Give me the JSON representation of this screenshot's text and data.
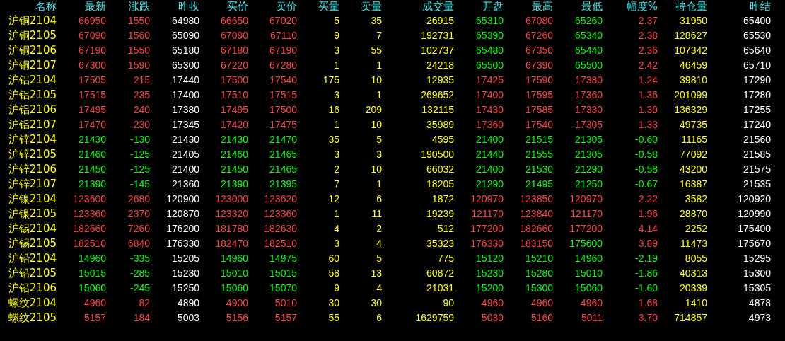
{
  "table": {
    "columns": [
      "名称",
      "最新",
      "涨跌",
      "昨收",
      "买价",
      "卖价",
      "买量",
      "卖量",
      "成交量",
      "开盘",
      "最高",
      "最低",
      "幅度%",
      "持仓量",
      "昨结"
    ],
    "rows": [
      {
        "cells": [
          {
            "text": "沪铜2104",
            "color": "#ffff00"
          },
          {
            "text": "66950",
            "color": "#ff4040"
          },
          {
            "text": "1550",
            "color": "#ff4040"
          },
          {
            "text": "64980",
            "color": "#ffffff"
          },
          {
            "text": "66650",
            "color": "#ff4040"
          },
          {
            "text": "67020",
            "color": "#ff4040"
          },
          {
            "text": "5",
            "color": "#ffff00"
          },
          {
            "text": "35",
            "color": "#ffff00"
          },
          {
            "text": "26915",
            "color": "#ffff00"
          },
          {
            "text": "65310",
            "color": "#00ff00"
          },
          {
            "text": "67080",
            "color": "#ff4040"
          },
          {
            "text": "65260",
            "color": "#00ff00"
          },
          {
            "text": "2.37",
            "color": "#ff4040"
          },
          {
            "text": "31950",
            "color": "#ffff00"
          },
          {
            "text": "65400",
            "color": "#ffffff"
          }
        ]
      },
      {
        "cells": [
          {
            "text": "沪铜2105",
            "color": "#ffff00"
          },
          {
            "text": "67090",
            "color": "#ff4040"
          },
          {
            "text": "1560",
            "color": "#ff4040"
          },
          {
            "text": "65090",
            "color": "#ffffff"
          },
          {
            "text": "67090",
            "color": "#ff4040"
          },
          {
            "text": "67110",
            "color": "#ff4040"
          },
          {
            "text": "9",
            "color": "#ffff00"
          },
          {
            "text": "7",
            "color": "#ffff00"
          },
          {
            "text": "192731",
            "color": "#ffff00"
          },
          {
            "text": "65390",
            "color": "#00ff00"
          },
          {
            "text": "67260",
            "color": "#ff4040"
          },
          {
            "text": "65340",
            "color": "#00ff00"
          },
          {
            "text": "2.38",
            "color": "#ff4040"
          },
          {
            "text": "128627",
            "color": "#ffff00"
          },
          {
            "text": "65530",
            "color": "#ffffff"
          }
        ]
      },
      {
        "cells": [
          {
            "text": "沪铜2106",
            "color": "#ffff00"
          },
          {
            "text": "67190",
            "color": "#ff4040"
          },
          {
            "text": "1550",
            "color": "#ff4040"
          },
          {
            "text": "65180",
            "color": "#ffffff"
          },
          {
            "text": "67180",
            "color": "#ff4040"
          },
          {
            "text": "67190",
            "color": "#ff4040"
          },
          {
            "text": "3",
            "color": "#ffff00"
          },
          {
            "text": "55",
            "color": "#ffff00"
          },
          {
            "text": "102737",
            "color": "#ffff00"
          },
          {
            "text": "65480",
            "color": "#00ff00"
          },
          {
            "text": "67350",
            "color": "#ff4040"
          },
          {
            "text": "65440",
            "color": "#00ff00"
          },
          {
            "text": "2.36",
            "color": "#ff4040"
          },
          {
            "text": "107342",
            "color": "#ffff00"
          },
          {
            "text": "65640",
            "color": "#ffffff"
          }
        ]
      },
      {
        "cells": [
          {
            "text": "沪铜2107",
            "color": "#ffff00"
          },
          {
            "text": "67300",
            "color": "#ff4040"
          },
          {
            "text": "1590",
            "color": "#ff4040"
          },
          {
            "text": "65300",
            "color": "#ffffff"
          },
          {
            "text": "67220",
            "color": "#ff4040"
          },
          {
            "text": "67280",
            "color": "#ff4040"
          },
          {
            "text": "1",
            "color": "#ffff00"
          },
          {
            "text": "1",
            "color": "#ffff00"
          },
          {
            "text": "24218",
            "color": "#ffff00"
          },
          {
            "text": "65500",
            "color": "#00ff00"
          },
          {
            "text": "67390",
            "color": "#ff4040"
          },
          {
            "text": "65500",
            "color": "#00ff00"
          },
          {
            "text": "2.42",
            "color": "#ff4040"
          },
          {
            "text": "46459",
            "color": "#ffff00"
          },
          {
            "text": "65710",
            "color": "#ffffff"
          }
        ]
      },
      {
        "cells": [
          {
            "text": "沪铝2104",
            "color": "#ffff00"
          },
          {
            "text": "17505",
            "color": "#ff4040"
          },
          {
            "text": "215",
            "color": "#ff4040"
          },
          {
            "text": "17440",
            "color": "#ffffff"
          },
          {
            "text": "17500",
            "color": "#ff4040"
          },
          {
            "text": "17540",
            "color": "#ff4040"
          },
          {
            "text": "175",
            "color": "#ffff00"
          },
          {
            "text": "10",
            "color": "#ffff00"
          },
          {
            "text": "12935",
            "color": "#ffff00"
          },
          {
            "text": "17425",
            "color": "#ff4040"
          },
          {
            "text": "17590",
            "color": "#ff4040"
          },
          {
            "text": "17380",
            "color": "#ff4040"
          },
          {
            "text": "1.24",
            "color": "#ff4040"
          },
          {
            "text": "39810",
            "color": "#ffff00"
          },
          {
            "text": "17290",
            "color": "#ffffff"
          }
        ]
      },
      {
        "cells": [
          {
            "text": "沪铝2105",
            "color": "#ffff00"
          },
          {
            "text": "17515",
            "color": "#ff4040"
          },
          {
            "text": "235",
            "color": "#ff4040"
          },
          {
            "text": "17400",
            "color": "#ffffff"
          },
          {
            "text": "17510",
            "color": "#ff4040"
          },
          {
            "text": "17515",
            "color": "#ff4040"
          },
          {
            "text": "3",
            "color": "#ffff00"
          },
          {
            "text": "1",
            "color": "#ffff00"
          },
          {
            "text": "269652",
            "color": "#ffff00"
          },
          {
            "text": "17400",
            "color": "#ff4040"
          },
          {
            "text": "17595",
            "color": "#ff4040"
          },
          {
            "text": "17360",
            "color": "#ff4040"
          },
          {
            "text": "1.36",
            "color": "#ff4040"
          },
          {
            "text": "201099",
            "color": "#ffff00"
          },
          {
            "text": "17280",
            "color": "#ffffff"
          }
        ]
      },
      {
        "cells": [
          {
            "text": "沪铝2106",
            "color": "#ffff00"
          },
          {
            "text": "17495",
            "color": "#ff4040"
          },
          {
            "text": "240",
            "color": "#ff4040"
          },
          {
            "text": "17380",
            "color": "#ffffff"
          },
          {
            "text": "17495",
            "color": "#ff4040"
          },
          {
            "text": "17500",
            "color": "#ff4040"
          },
          {
            "text": "16",
            "color": "#ffff00"
          },
          {
            "text": "209",
            "color": "#ffff00"
          },
          {
            "text": "132115",
            "color": "#ffff00"
          },
          {
            "text": "17430",
            "color": "#ff4040"
          },
          {
            "text": "17585",
            "color": "#ff4040"
          },
          {
            "text": "17330",
            "color": "#ff4040"
          },
          {
            "text": "1.39",
            "color": "#ff4040"
          },
          {
            "text": "136329",
            "color": "#ffff00"
          },
          {
            "text": "17255",
            "color": "#ffffff"
          }
        ]
      },
      {
        "cells": [
          {
            "text": "沪铝2107",
            "color": "#ffff00"
          },
          {
            "text": "17470",
            "color": "#ff4040"
          },
          {
            "text": "230",
            "color": "#ff4040"
          },
          {
            "text": "17345",
            "color": "#ffffff"
          },
          {
            "text": "17420",
            "color": "#ff4040"
          },
          {
            "text": "17475",
            "color": "#ff4040"
          },
          {
            "text": "1",
            "color": "#ffff00"
          },
          {
            "text": "10",
            "color": "#ffff00"
          },
          {
            "text": "35989",
            "color": "#ffff00"
          },
          {
            "text": "17360",
            "color": "#ff4040"
          },
          {
            "text": "17540",
            "color": "#ff4040"
          },
          {
            "text": "17305",
            "color": "#ff4040"
          },
          {
            "text": "1.33",
            "color": "#ff4040"
          },
          {
            "text": "49735",
            "color": "#ffff00"
          },
          {
            "text": "17240",
            "color": "#ffffff"
          }
        ]
      },
      {
        "cells": [
          {
            "text": "沪锌2104",
            "color": "#ffff00"
          },
          {
            "text": "21430",
            "color": "#00ff00"
          },
          {
            "text": "-130",
            "color": "#00ff00"
          },
          {
            "text": "21430",
            "color": "#ffffff"
          },
          {
            "text": "21430",
            "color": "#00ff00"
          },
          {
            "text": "21470",
            "color": "#00ff00"
          },
          {
            "text": "35",
            "color": "#ffff00"
          },
          {
            "text": "5",
            "color": "#ffff00"
          },
          {
            "text": "4595",
            "color": "#ffff00"
          },
          {
            "text": "21400",
            "color": "#00ff00"
          },
          {
            "text": "21515",
            "color": "#00ff00"
          },
          {
            "text": "21305",
            "color": "#00ff00"
          },
          {
            "text": "-0.60",
            "color": "#00ff00"
          },
          {
            "text": "11165",
            "color": "#ffff00"
          },
          {
            "text": "21560",
            "color": "#ffffff"
          }
        ]
      },
      {
        "cells": [
          {
            "text": "沪锌2105",
            "color": "#ffff00"
          },
          {
            "text": "21460",
            "color": "#00ff00"
          },
          {
            "text": "-125",
            "color": "#00ff00"
          },
          {
            "text": "21405",
            "color": "#ffffff"
          },
          {
            "text": "21460",
            "color": "#00ff00"
          },
          {
            "text": "21465",
            "color": "#00ff00"
          },
          {
            "text": "3",
            "color": "#ffff00"
          },
          {
            "text": "3",
            "color": "#ffff00"
          },
          {
            "text": "190500",
            "color": "#ffff00"
          },
          {
            "text": "21440",
            "color": "#00ff00"
          },
          {
            "text": "21555",
            "color": "#00ff00"
          },
          {
            "text": "21305",
            "color": "#00ff00"
          },
          {
            "text": "-0.58",
            "color": "#00ff00"
          },
          {
            "text": "77092",
            "color": "#ffff00"
          },
          {
            "text": "21585",
            "color": "#ffffff"
          }
        ]
      },
      {
        "cells": [
          {
            "text": "沪锌2106",
            "color": "#ffff00"
          },
          {
            "text": "21450",
            "color": "#00ff00"
          },
          {
            "text": "-125",
            "color": "#00ff00"
          },
          {
            "text": "21400",
            "color": "#ffffff"
          },
          {
            "text": "21450",
            "color": "#00ff00"
          },
          {
            "text": "21465",
            "color": "#00ff00"
          },
          {
            "text": "2",
            "color": "#ffff00"
          },
          {
            "text": "10",
            "color": "#ffff00"
          },
          {
            "text": "66032",
            "color": "#ffff00"
          },
          {
            "text": "21400",
            "color": "#00ff00"
          },
          {
            "text": "21530",
            "color": "#00ff00"
          },
          {
            "text": "21290",
            "color": "#00ff00"
          },
          {
            "text": "-0.58",
            "color": "#00ff00"
          },
          {
            "text": "43200",
            "color": "#ffff00"
          },
          {
            "text": "21575",
            "color": "#ffffff"
          }
        ]
      },
      {
        "cells": [
          {
            "text": "沪锌2107",
            "color": "#ffff00"
          },
          {
            "text": "21390",
            "color": "#00ff00"
          },
          {
            "text": "-145",
            "color": "#00ff00"
          },
          {
            "text": "21360",
            "color": "#ffffff"
          },
          {
            "text": "21390",
            "color": "#00ff00"
          },
          {
            "text": "21395",
            "color": "#00ff00"
          },
          {
            "text": "7",
            "color": "#ffff00"
          },
          {
            "text": "1",
            "color": "#ffff00"
          },
          {
            "text": "18205",
            "color": "#ffff00"
          },
          {
            "text": "21290",
            "color": "#00ff00"
          },
          {
            "text": "21495",
            "color": "#00ff00"
          },
          {
            "text": "21250",
            "color": "#00ff00"
          },
          {
            "text": "-0.67",
            "color": "#00ff00"
          },
          {
            "text": "16387",
            "color": "#ffff00"
          },
          {
            "text": "21535",
            "color": "#ffffff"
          }
        ]
      },
      {
        "cells": [
          {
            "text": "沪镍2104",
            "color": "#ffff00"
          },
          {
            "text": "123600",
            "color": "#ff4040"
          },
          {
            "text": "2680",
            "color": "#ff4040"
          },
          {
            "text": "120900",
            "color": "#ffffff"
          },
          {
            "text": "123000",
            "color": "#ff4040"
          },
          {
            "text": "123620",
            "color": "#ff4040"
          },
          {
            "text": "12",
            "color": "#ffff00"
          },
          {
            "text": "6",
            "color": "#ffff00"
          },
          {
            "text": "1872",
            "color": "#ffff00"
          },
          {
            "text": "120970",
            "color": "#ff4040"
          },
          {
            "text": "123850",
            "color": "#ff4040"
          },
          {
            "text": "120970",
            "color": "#ff4040"
          },
          {
            "text": "2.22",
            "color": "#ff4040"
          },
          {
            "text": "3582",
            "color": "#ffff00"
          },
          {
            "text": "120920",
            "color": "#ffffff"
          }
        ]
      },
      {
        "cells": [
          {
            "text": "沪镍2105",
            "color": "#ffff00"
          },
          {
            "text": "123360",
            "color": "#ff4040"
          },
          {
            "text": "2370",
            "color": "#ff4040"
          },
          {
            "text": "120870",
            "color": "#ffffff"
          },
          {
            "text": "123320",
            "color": "#ff4040"
          },
          {
            "text": "123360",
            "color": "#ff4040"
          },
          {
            "text": "1",
            "color": "#ffff00"
          },
          {
            "text": "11",
            "color": "#ffff00"
          },
          {
            "text": "19239",
            "color": "#ffff00"
          },
          {
            "text": "121170",
            "color": "#ff4040"
          },
          {
            "text": "123840",
            "color": "#ff4040"
          },
          {
            "text": "121170",
            "color": "#ff4040"
          },
          {
            "text": "1.96",
            "color": "#ff4040"
          },
          {
            "text": "28870",
            "color": "#ffff00"
          },
          {
            "text": "120990",
            "color": "#ffffff"
          }
        ]
      },
      {
        "cells": [
          {
            "text": "沪锡2104",
            "color": "#ffff00"
          },
          {
            "text": "182660",
            "color": "#ff4040"
          },
          {
            "text": "7260",
            "color": "#ff4040"
          },
          {
            "text": "176200",
            "color": "#ffffff"
          },
          {
            "text": "181780",
            "color": "#ff4040"
          },
          {
            "text": "182630",
            "color": "#ff4040"
          },
          {
            "text": "4",
            "color": "#ffff00"
          },
          {
            "text": "2",
            "color": "#ffff00"
          },
          {
            "text": "512",
            "color": "#ffff00"
          },
          {
            "text": "177200",
            "color": "#ff4040"
          },
          {
            "text": "182660",
            "color": "#ff4040"
          },
          {
            "text": "177200",
            "color": "#ff4040"
          },
          {
            "text": "4.14",
            "color": "#ff4040"
          },
          {
            "text": "2252",
            "color": "#ffff00"
          },
          {
            "text": "175400",
            "color": "#ffffff"
          }
        ]
      },
      {
        "cells": [
          {
            "text": "沪锡2105",
            "color": "#ffff00"
          },
          {
            "text": "182510",
            "color": "#ff4040"
          },
          {
            "text": "6840",
            "color": "#ff4040"
          },
          {
            "text": "176330",
            "color": "#ffffff"
          },
          {
            "text": "182470",
            "color": "#ff4040"
          },
          {
            "text": "182510",
            "color": "#ff4040"
          },
          {
            "text": "3",
            "color": "#ffff00"
          },
          {
            "text": "4",
            "color": "#ffff00"
          },
          {
            "text": "35323",
            "color": "#ffff00"
          },
          {
            "text": "176330",
            "color": "#ff4040"
          },
          {
            "text": "183150",
            "color": "#ff4040"
          },
          {
            "text": "175600",
            "color": "#00ff00"
          },
          {
            "text": "3.89",
            "color": "#ff4040"
          },
          {
            "text": "11473",
            "color": "#ffff00"
          },
          {
            "text": "175670",
            "color": "#ffffff"
          }
        ]
      },
      {
        "cells": [
          {
            "text": "沪铅2104",
            "color": "#ffff00"
          },
          {
            "text": "14960",
            "color": "#00ff00"
          },
          {
            "text": "-335",
            "color": "#00ff00"
          },
          {
            "text": "15205",
            "color": "#ffffff"
          },
          {
            "text": "14960",
            "color": "#00ff00"
          },
          {
            "text": "14975",
            "color": "#00ff00"
          },
          {
            "text": "60",
            "color": "#ffff00"
          },
          {
            "text": "5",
            "color": "#ffff00"
          },
          {
            "text": "775",
            "color": "#ffff00"
          },
          {
            "text": "15120",
            "color": "#00ff00"
          },
          {
            "text": "15210",
            "color": "#00ff00"
          },
          {
            "text": "14960",
            "color": "#00ff00"
          },
          {
            "text": "-2.19",
            "color": "#00ff00"
          },
          {
            "text": "8055",
            "color": "#ffff00"
          },
          {
            "text": "15295",
            "color": "#ffffff"
          }
        ]
      },
      {
        "cells": [
          {
            "text": "沪铅2105",
            "color": "#ffff00"
          },
          {
            "text": "15015",
            "color": "#00ff00"
          },
          {
            "text": "-285",
            "color": "#00ff00"
          },
          {
            "text": "15230",
            "color": "#ffffff"
          },
          {
            "text": "15010",
            "color": "#00ff00"
          },
          {
            "text": "15015",
            "color": "#00ff00"
          },
          {
            "text": "58",
            "color": "#ffff00"
          },
          {
            "text": "13",
            "color": "#ffff00"
          },
          {
            "text": "60872",
            "color": "#ffff00"
          },
          {
            "text": "15230",
            "color": "#00ff00"
          },
          {
            "text": "15280",
            "color": "#00ff00"
          },
          {
            "text": "15010",
            "color": "#00ff00"
          },
          {
            "text": "-1.86",
            "color": "#00ff00"
          },
          {
            "text": "40313",
            "color": "#ffff00"
          },
          {
            "text": "15300",
            "color": "#ffffff"
          }
        ]
      },
      {
        "cells": [
          {
            "text": "沪铅2106",
            "color": "#ffff00"
          },
          {
            "text": "15060",
            "color": "#00ff00"
          },
          {
            "text": "-245",
            "color": "#00ff00"
          },
          {
            "text": "15250",
            "color": "#ffffff"
          },
          {
            "text": "15060",
            "color": "#00ff00"
          },
          {
            "text": "15070",
            "color": "#00ff00"
          },
          {
            "text": "9",
            "color": "#ffff00"
          },
          {
            "text": "4",
            "color": "#ffff00"
          },
          {
            "text": "21031",
            "color": "#ffff00"
          },
          {
            "text": "15200",
            "color": "#00ff00"
          },
          {
            "text": "15300",
            "color": "#00ff00"
          },
          {
            "text": "15060",
            "color": "#00ff00"
          },
          {
            "text": "-1.60",
            "color": "#00ff00"
          },
          {
            "text": "20339",
            "color": "#ffff00"
          },
          {
            "text": "15305",
            "color": "#ffffff"
          }
        ]
      },
      {
        "cells": [
          {
            "text": "螺纹2104",
            "color": "#ffff00"
          },
          {
            "text": "4960",
            "color": "#ff4040"
          },
          {
            "text": "82",
            "color": "#ff4040"
          },
          {
            "text": "4890",
            "color": "#ffffff"
          },
          {
            "text": "4900",
            "color": "#ff4040"
          },
          {
            "text": "5010",
            "color": "#ff4040"
          },
          {
            "text": "30",
            "color": "#ffff00"
          },
          {
            "text": "30",
            "color": "#ffff00"
          },
          {
            "text": "90",
            "color": "#ffff00"
          },
          {
            "text": "4960",
            "color": "#ff4040"
          },
          {
            "text": "4960",
            "color": "#ff4040"
          },
          {
            "text": "4960",
            "color": "#ff4040"
          },
          {
            "text": "1.68",
            "color": "#ff4040"
          },
          {
            "text": "1410",
            "color": "#ffff00"
          },
          {
            "text": "4878",
            "color": "#ffffff"
          }
        ]
      },
      {
        "cells": [
          {
            "text": "螺纹2105",
            "color": "#ffff00"
          },
          {
            "text": "5157",
            "color": "#ff4040"
          },
          {
            "text": "184",
            "color": "#ff4040"
          },
          {
            "text": "5003",
            "color": "#ffffff"
          },
          {
            "text": "5156",
            "color": "#ff4040"
          },
          {
            "text": "5157",
            "color": "#ff4040"
          },
          {
            "text": "55",
            "color": "#ffff00"
          },
          {
            "text": "6",
            "color": "#ffff00"
          },
          {
            "text": "1629759",
            "color": "#ffff00"
          },
          {
            "text": "5030",
            "color": "#ff4040"
          },
          {
            "text": "5160",
            "color": "#ff4040"
          },
          {
            "text": "5011",
            "color": "#ff4040"
          },
          {
            "text": "3.70",
            "color": "#ff4040"
          },
          {
            "text": "714857",
            "color": "#ffff00"
          },
          {
            "text": "4973",
            "color": "#ffffff"
          }
        ]
      }
    ]
  }
}
